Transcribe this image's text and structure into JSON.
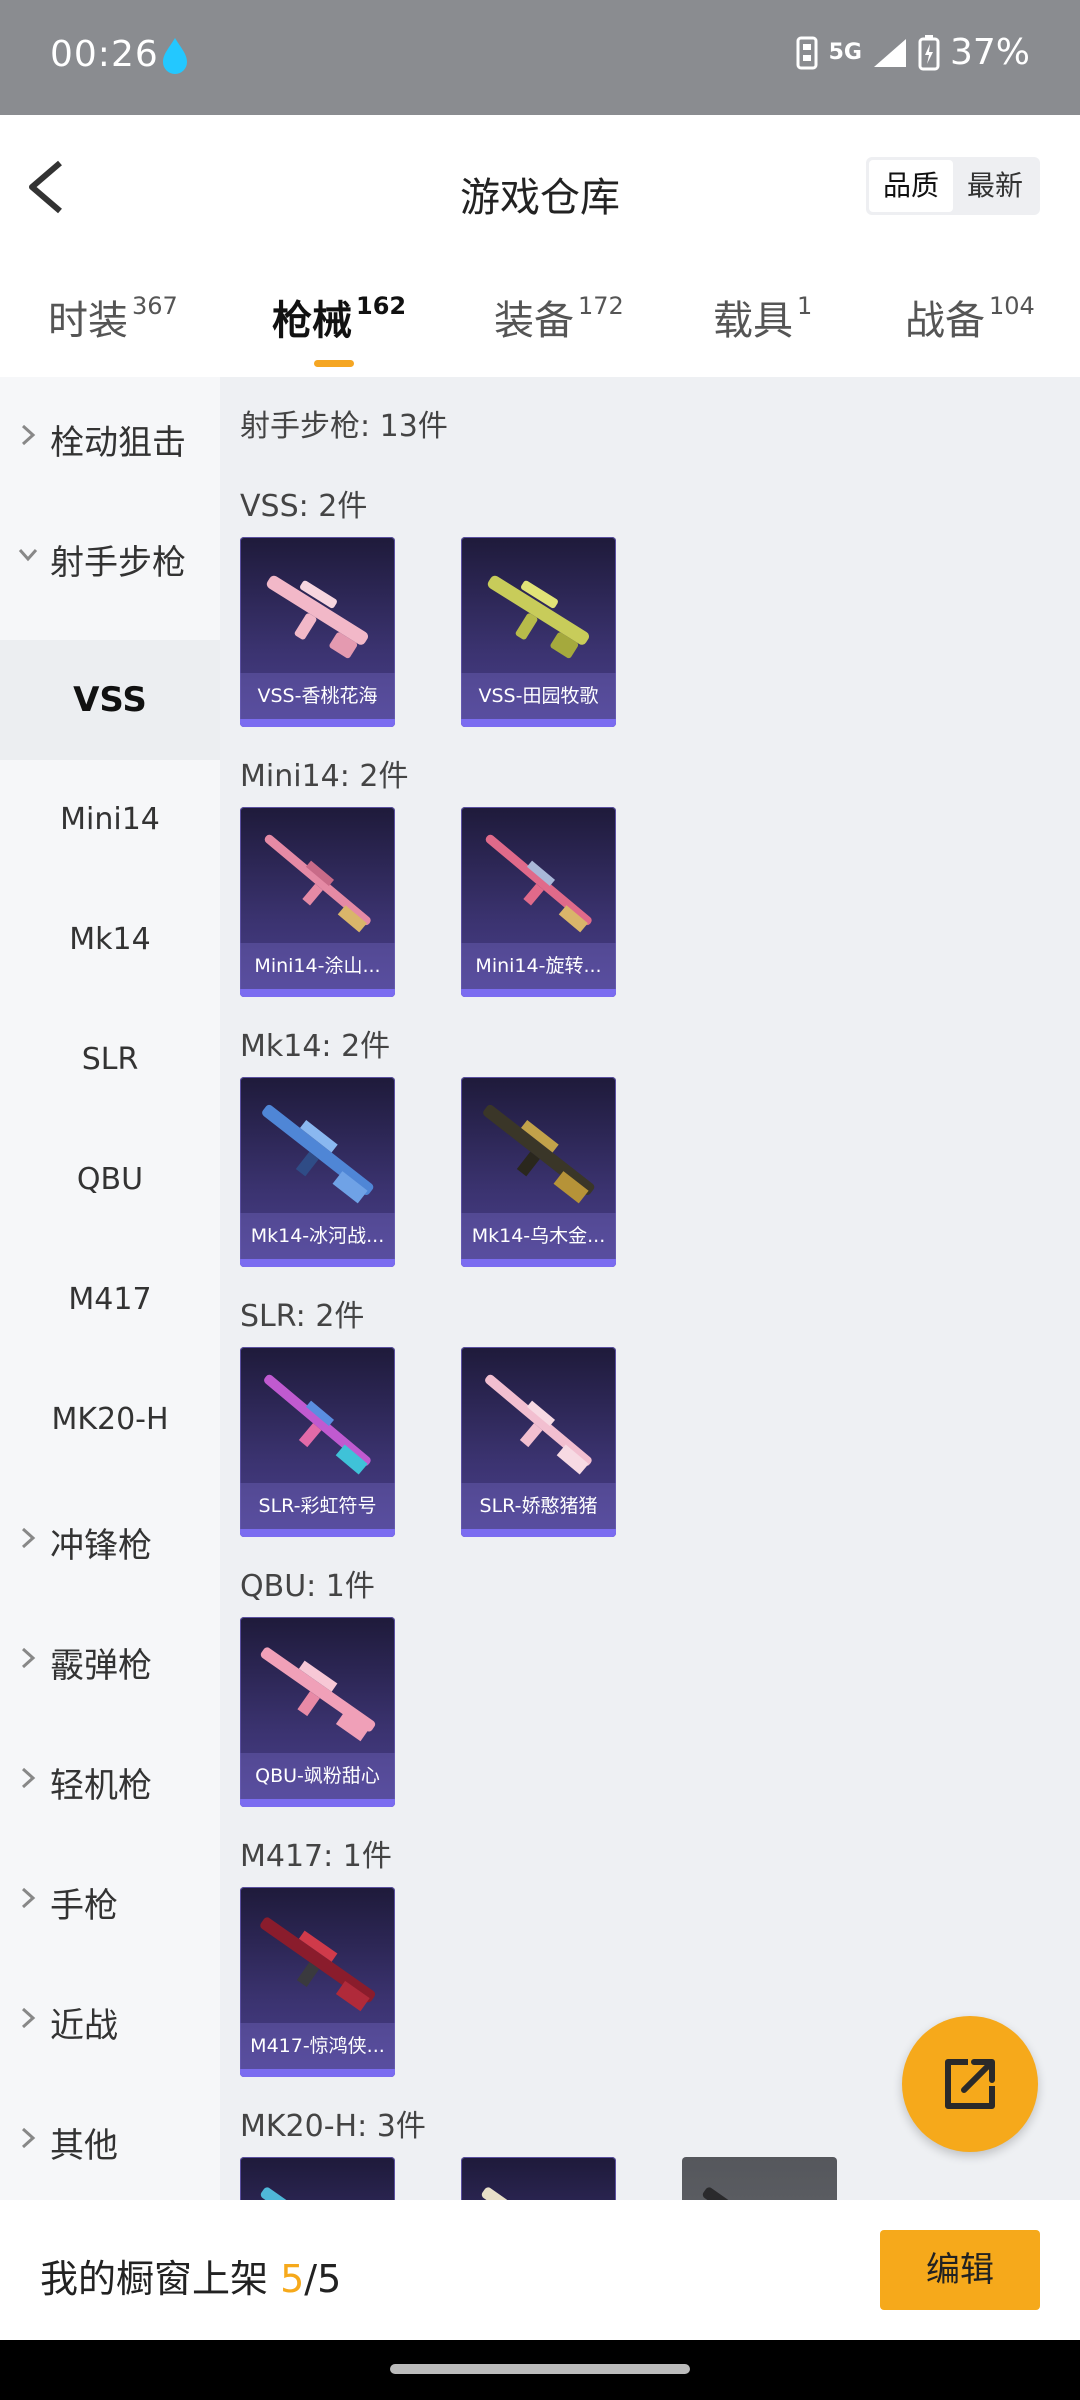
{
  "status": {
    "time": "00:26",
    "network": "5G",
    "battery": "37%"
  },
  "header": {
    "title": "游戏仓库",
    "sort_options": [
      "品质",
      "最新"
    ]
  },
  "tabs": [
    {
      "label": "时装",
      "count": "367"
    },
    {
      "label": "枪械",
      "count": "162"
    },
    {
      "label": "装备",
      "count": "172"
    },
    {
      "label": "载具",
      "count": "1"
    },
    {
      "label": "战备",
      "count": "104"
    }
  ],
  "sidebar": {
    "top": [
      {
        "label": "栓动狙击"
      },
      {
        "label": "射手步枪"
      }
    ],
    "sub": [
      "VSS",
      "Mini14",
      "Mk14",
      "SLR",
      "QBU",
      "M417",
      "MK20-H"
    ],
    "bottom": [
      {
        "label": "冲锋枪"
      },
      {
        "label": "霰弹枪"
      },
      {
        "label": "轻机枪"
      },
      {
        "label": "手枪"
      },
      {
        "label": "近战"
      },
      {
        "label": "其他"
      }
    ]
  },
  "content": {
    "category_title": "射手步枪: 13件",
    "sections": [
      {
        "title": "VSS: 2件",
        "items": [
          "VSS-香桃花海",
          "VSS-田园牧歌"
        ]
      },
      {
        "title": "Mini14: 2件",
        "items": [
          "Mini14-涂山...",
          "Mini14-旋转..."
        ]
      },
      {
        "title": "Mk14: 2件",
        "items": [
          "Mk14-冰河战...",
          "Mk14-乌木金..."
        ]
      },
      {
        "title": "SLR: 2件",
        "items": [
          "SLR-彩虹符号",
          "SLR-娇憨猪猪"
        ]
      },
      {
        "title": "QBU: 1件",
        "items": [
          "QBU-飒粉甜心"
        ]
      },
      {
        "title": "M417: 1件",
        "items": [
          "M417-惊鸿侠..."
        ]
      },
      {
        "title": "MK20-H: 3件",
        "items": [
          "",
          "",
          ""
        ]
      }
    ]
  },
  "bottom": {
    "label": "我的橱窗上架",
    "count": "5",
    "total": "/5",
    "edit": "编辑"
  },
  "colors": {
    "accent": "#f6a91b",
    "card_bg": "#3b3370"
  }
}
